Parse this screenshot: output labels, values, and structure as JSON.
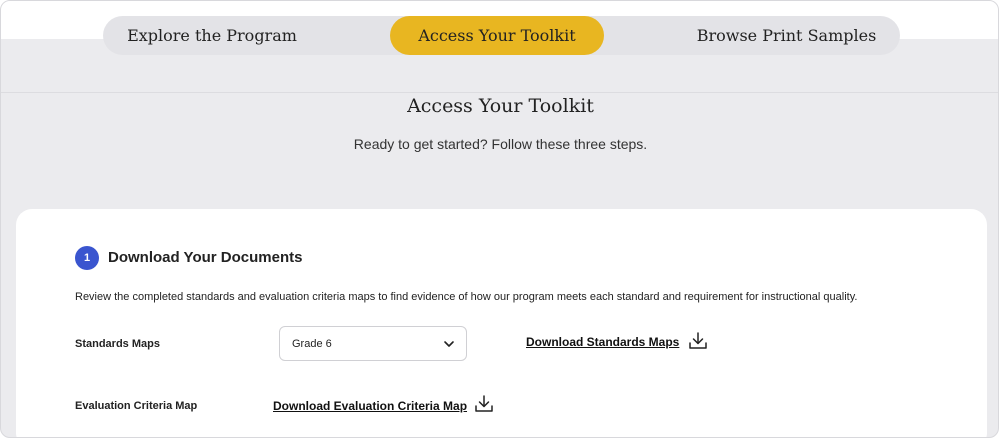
{
  "nav": {
    "tabs": [
      {
        "label": "Explore the Program",
        "active": false
      },
      {
        "label": "Access Your Toolkit",
        "active": true
      },
      {
        "label": "Browse Print Samples",
        "active": false
      }
    ],
    "active_color": "#e8b621"
  },
  "hero": {
    "title": "Access Your Toolkit",
    "subtitle": "Ready to get started? Follow these three steps."
  },
  "step1": {
    "number": "1",
    "badge_color": "#3a55cf",
    "title": "Download Your Documents",
    "description": "Review the completed standards and evaluation criteria maps to find evidence of how our program meets each standard and requirement for instructional quality.",
    "rows": [
      {
        "label": "Standards Maps",
        "select_value": "Grade 6",
        "link": "Download Standards Maps",
        "icon": "download-icon"
      },
      {
        "label": "Evaluation Criteria Map",
        "link": "Download Evaluation Criteria Map",
        "icon": "download-icon"
      }
    ]
  }
}
